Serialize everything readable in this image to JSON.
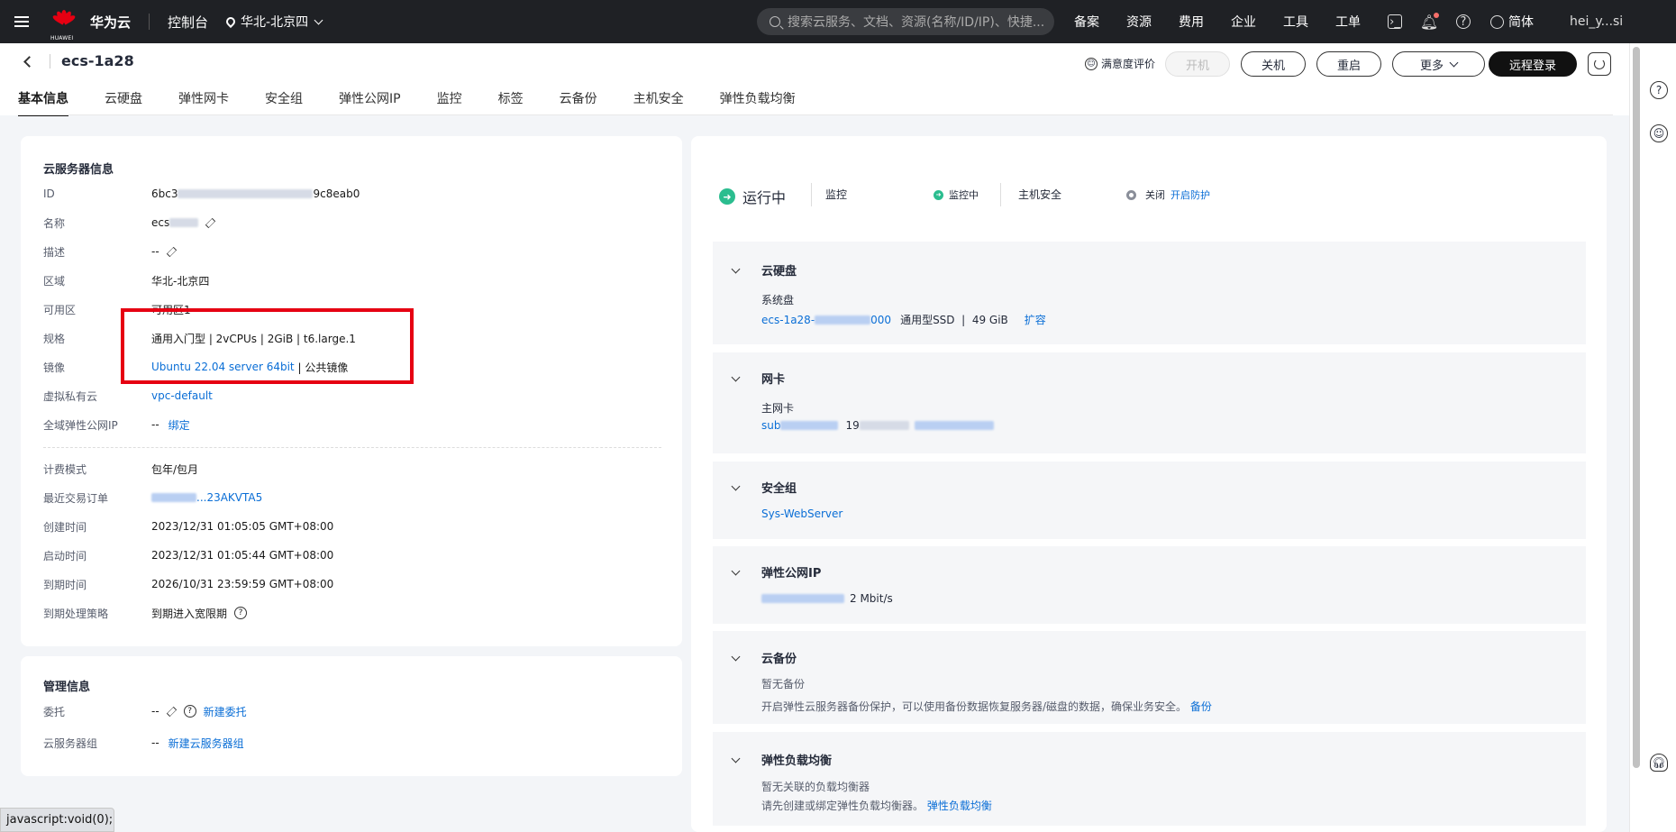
{
  "topbar": {
    "brand_sub": "HUAWEI",
    "brand": "华为云",
    "console": "控制台",
    "region": "华北-北京四",
    "search_placeholder": "搜索云服务、文档、资源(名称/ID/IP)、快捷...",
    "nav": [
      "备案",
      "资源",
      "费用",
      "企业",
      "工具",
      "工单"
    ],
    "lang": "简体",
    "account": "hei_y...si"
  },
  "header": {
    "title": "ecs-1a28",
    "rating": "满意度评价",
    "buttons": {
      "power_on": "开机",
      "power_off": "关机",
      "restart": "重启",
      "more": "更多",
      "remote_login": "远程登录"
    },
    "tabs": [
      "基本信息",
      "云硬盘",
      "弹性网卡",
      "安全组",
      "弹性公网IP",
      "监控",
      "标签",
      "云备份",
      "主机安全",
      "弹性负载均衡"
    ]
  },
  "server_info": {
    "title": "云服务器信息",
    "id_label": "ID",
    "id_prefix": "6bc3",
    "id_suffix": "9c8eab0",
    "name_label": "名称",
    "name_prefix": "ecs",
    "desc_label": "描述",
    "desc_value": "--",
    "region_label": "区域",
    "region_value": "华北-北京四",
    "az_label": "可用区",
    "az_value": "可用区1",
    "spec_label": "规格",
    "spec_value": "通用入门型 | 2vCPUs | 2GiB | t6.large.1",
    "image_label": "镜像",
    "image_link": "Ubuntu 22.04 server 64bit",
    "image_suffix": " | 公共镜像",
    "vpc_label": "虚拟私有云",
    "vpc_value": "vpc-default",
    "gip_label": "全域弹性公网IP",
    "gip_value": "--",
    "gip_bind": "绑定",
    "billing_label": "计费模式",
    "billing_value": "包年/包月",
    "order_label": "最近交易订单",
    "order_value": "...23AKVTA5",
    "created_label": "创建时间",
    "created_value": "2023/12/31 01:05:05 GMT+08:00",
    "started_label": "启动时间",
    "started_value": "2023/12/31 01:05:44 GMT+08:00",
    "expire_label": "到期时间",
    "expire_value": "2026/10/31 23:59:59 GMT+08:00",
    "policy_label": "到期处理策略",
    "policy_value": "到期进入宽限期"
  },
  "mgmt_info": {
    "title": "管理信息",
    "agency_label": "委托",
    "agency_value": "--",
    "agency_link": "新建委托",
    "group_label": "云服务器组",
    "group_value": "--",
    "group_link": "新建云服务器组"
  },
  "status": {
    "state": "运行中",
    "monitor_label": "监控",
    "monitor_state": "监控中",
    "hss_label": "主机安全",
    "hss_state": "关闭",
    "hss_link": "开启防护"
  },
  "cards": {
    "disk": {
      "title": "云硬盘",
      "sub": "系统盘",
      "link_prefix": "ecs-1a28-",
      "link_suffix": "000",
      "type": "通用型SSD  |  49 GiB",
      "expand": "扩容"
    },
    "nic": {
      "title": "网卡",
      "sub": "主网卡",
      "link_prefix": "sub",
      "ip_prefix": "19"
    },
    "sg": {
      "title": "安全组",
      "link": "Sys-WebServer"
    },
    "eip": {
      "title": "弹性公网IP",
      "bandwidth": "2 Mbit/s"
    },
    "backup": {
      "title": "云备份",
      "none": "暂无备份",
      "desc": "开启弹性云服务器备份保护，可以使用备份数据恢复服务器/磁盘的数据，确保业务安全。",
      "link": "备份"
    },
    "elb": {
      "title": "弹性负载均衡",
      "none": "暂无关联的负载均衡器",
      "desc": "请先创建或绑定弹性负载均衡器。",
      "link": "弹性负载均衡"
    }
  },
  "statusbar": "javascript:void(0);",
  "colors": {
    "accent": "#0a6ed6",
    "running": "#2bbd8f",
    "highlight": "#e60012"
  }
}
